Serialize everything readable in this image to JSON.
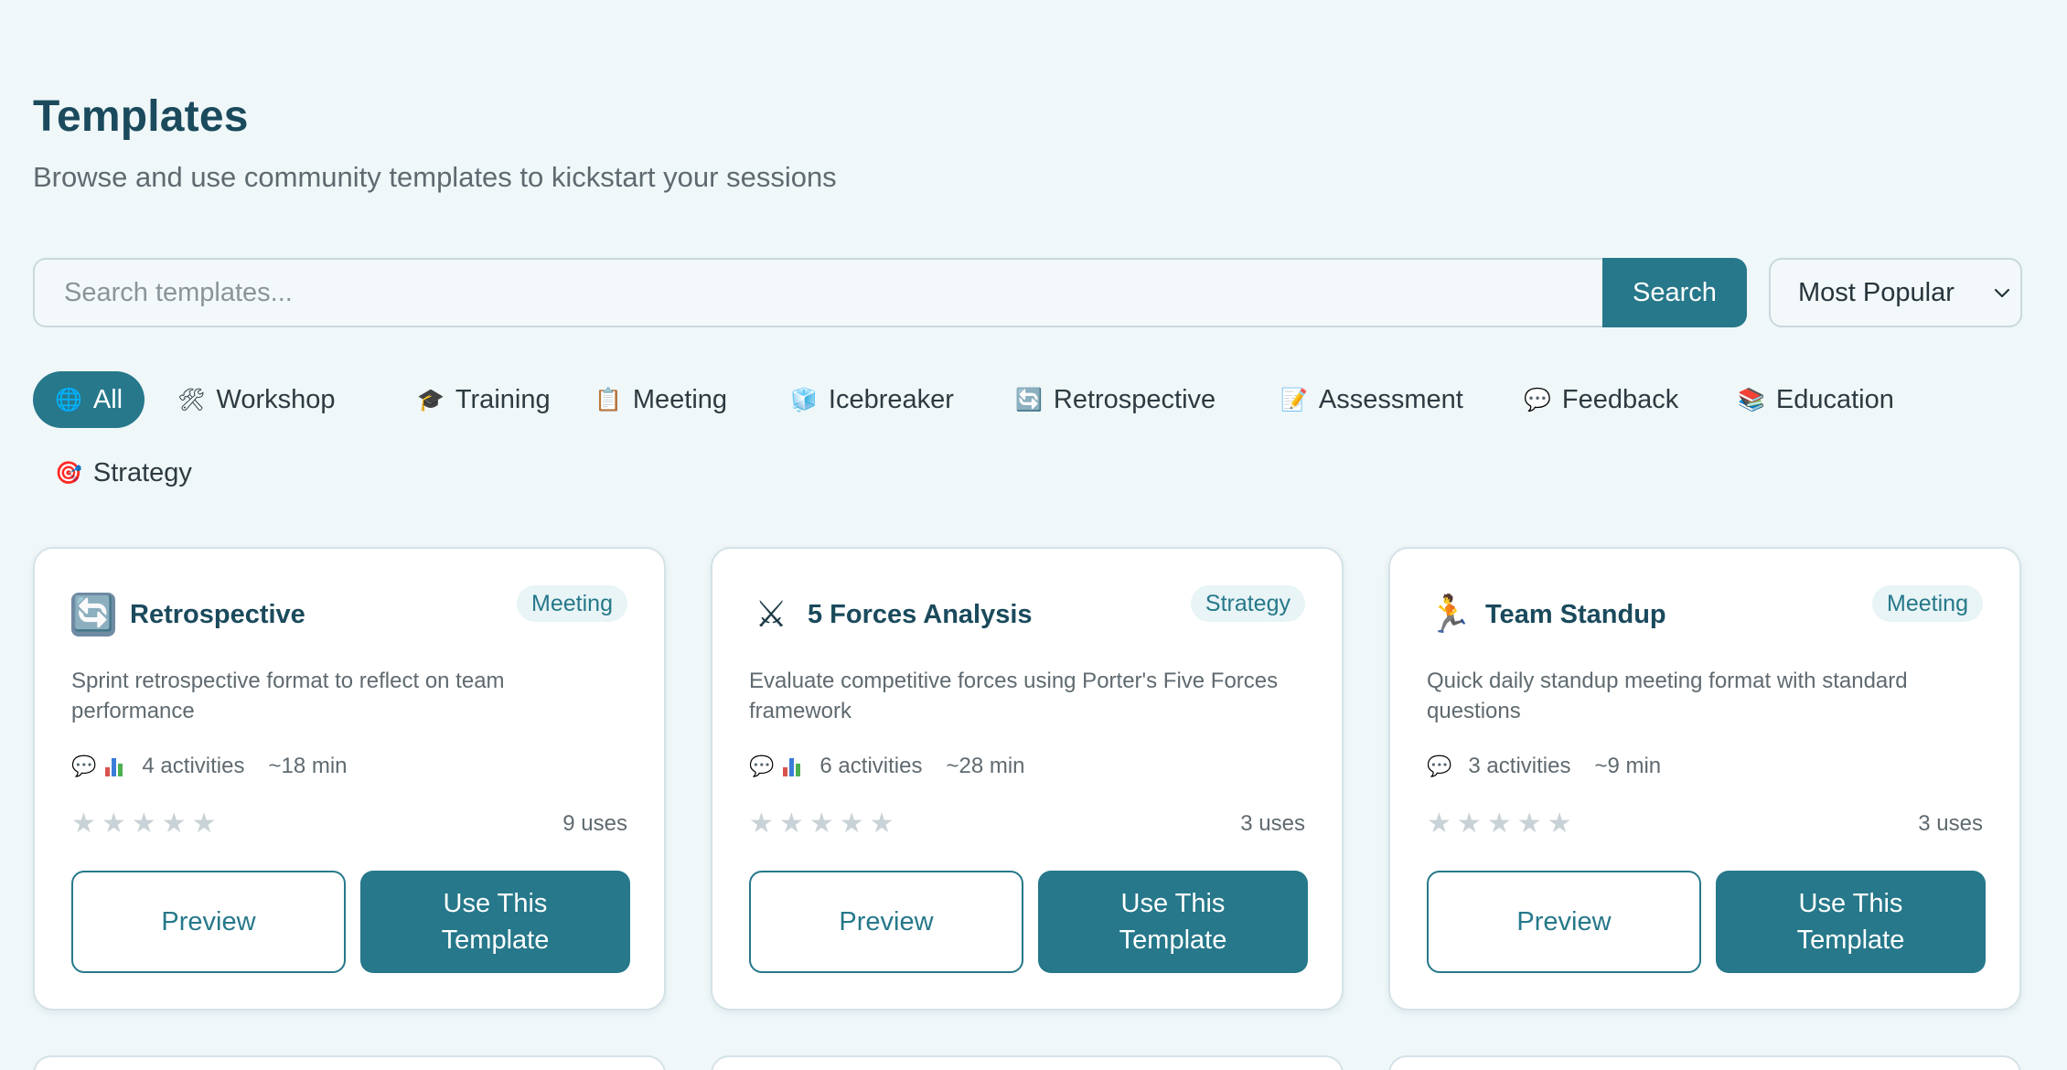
{
  "header": {
    "title": "Templates",
    "subtitle": "Browse and use community templates to kickstart your sessions"
  },
  "search": {
    "placeholder": "Search templates...",
    "button_label": "Search",
    "sort_selected": "Most Popular"
  },
  "filters": [
    {
      "icon": "🌐",
      "label": "All",
      "active": true
    },
    {
      "icon": "🛠",
      "label": "Workshop",
      "active": false
    },
    {
      "icon": "🎓",
      "label": "Training",
      "active": false
    },
    {
      "icon": "📋",
      "label": "Meeting",
      "active": false
    },
    {
      "icon": "🧊",
      "label": "Icebreaker",
      "active": false
    },
    {
      "icon": "🔄",
      "label": "Retrospective",
      "active": false
    },
    {
      "icon": "📝",
      "label": "Assessment",
      "active": false
    },
    {
      "icon": "💬",
      "label": "Feedback",
      "active": false
    },
    {
      "icon": "📚",
      "label": "Education",
      "active": false
    },
    {
      "icon": "🎯",
      "label": "Strategy",
      "active": false
    }
  ],
  "cards": [
    {
      "icon": "🔄",
      "title": "Retrospective",
      "badge": "Meeting",
      "description": "Sprint retrospective format to reflect on team performance",
      "activities": "4 activities",
      "duration": "~18 min",
      "rating": 0,
      "uses": "9 uses",
      "preview_label": "Preview",
      "use_label": "Use This Template"
    },
    {
      "icon": "⚔",
      "title": "5 Forces Analysis",
      "badge": "Strategy",
      "description": "Evaluate competitive forces using Porter's Five Forces framework",
      "activities": "6 activities",
      "duration": "~28 min",
      "rating": 0,
      "uses": "3 uses",
      "preview_label": "Preview",
      "use_label": "Use This Template"
    },
    {
      "icon": "🏃",
      "title": "Team Standup",
      "badge": "Meeting",
      "description": "Quick daily standup meeting format with standard questions",
      "activities": "3 activities",
      "duration": "~9 min",
      "rating": 0,
      "uses": "3 uses",
      "preview_label": "Preview",
      "use_label": "Use This Template"
    }
  ],
  "colors": {
    "accent": "#26788a",
    "title": "#1a4a5c",
    "background": "#eff7f9",
    "star_empty": "#c9d2d6"
  }
}
